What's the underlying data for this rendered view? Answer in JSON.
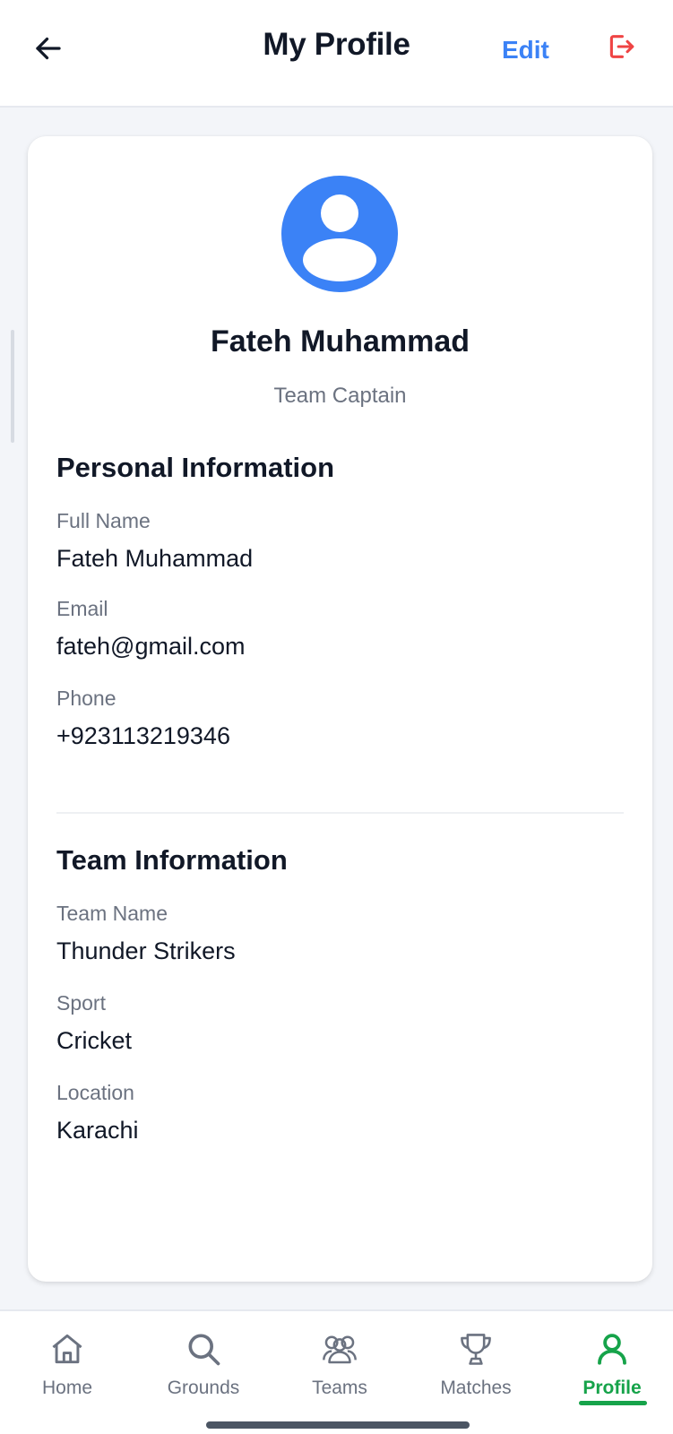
{
  "header": {
    "title": "My Profile",
    "edit_label": "Edit",
    "back_icon": "arrow-left-icon",
    "logout_icon": "logout-icon"
  },
  "profile": {
    "avatar_icon": "user-avatar-icon",
    "name": "Fateh Muhammad",
    "role": "Team Captain"
  },
  "personal_info": {
    "title": "Personal Information",
    "fields": [
      {
        "label": "Full Name",
        "value": "Fateh Muhammad"
      },
      {
        "label": "Email",
        "value": "fateh@gmail.com"
      },
      {
        "label": "Phone",
        "value": "+923113219346"
      }
    ]
  },
  "team_info": {
    "title": "Team Information",
    "fields": [
      {
        "label": "Team Name",
        "value": "Thunder Strikers"
      },
      {
        "label": "Sport",
        "value": "Cricket"
      },
      {
        "label": "Location",
        "value": "Karachi"
      }
    ]
  },
  "nav": {
    "items": [
      {
        "label": "Home",
        "icon": "home-icon",
        "active": false
      },
      {
        "label": "Grounds",
        "icon": "search-icon",
        "active": false
      },
      {
        "label": "Teams",
        "icon": "teams-icon",
        "active": false
      },
      {
        "label": "Matches",
        "icon": "trophy-icon",
        "active": false
      },
      {
        "label": "Profile",
        "icon": "user-icon",
        "active": true
      }
    ]
  },
  "colors": {
    "accent_blue": "#3b82f6",
    "active_green": "#16a34a",
    "logout_red": "#ef4444"
  }
}
